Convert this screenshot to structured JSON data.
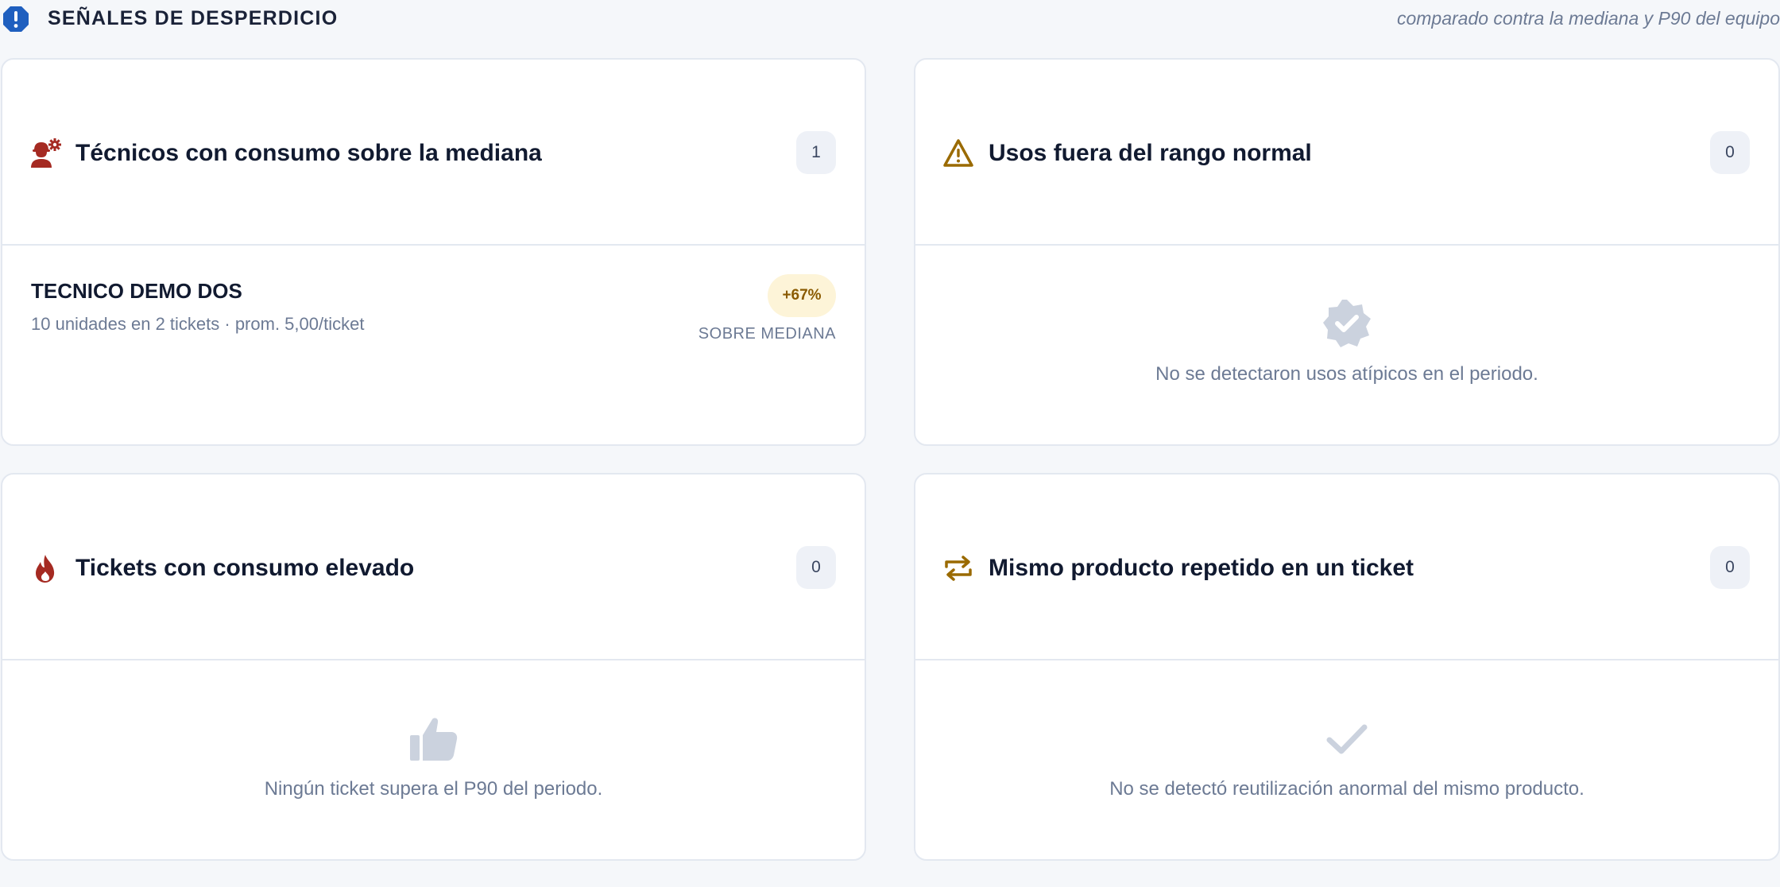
{
  "header": {
    "icon": "alert-octagon-icon",
    "title": "SEÑALES DE DESPERDICIO",
    "subtitle": "comparado contra la mediana y P90 del equipo"
  },
  "colors": {
    "accent_blue": "#1f5fbf",
    "danger_red": "#a52a22",
    "warning_amber": "#9a6a00",
    "muted_icon": "#cbd2de",
    "badge_bg": "#eef1f7",
    "percent_badge_bg": "#fdf4d8"
  },
  "cards": [
    {
      "icon": "user-gear-icon",
      "title": "Técnicos con consumo sobre la mediana",
      "count": "1",
      "rows": [
        {
          "name": "TECNICO DEMO DOS",
          "detail": "10 unidades en 2 tickets · prom. 5,00/ticket",
          "percent": "+67%",
          "percent_label": "SOBRE MEDIANA"
        }
      ]
    },
    {
      "icon": "warning-triangle-icon",
      "title": "Usos fuera del rango normal",
      "count": "0",
      "empty_icon": "verified-badge-icon",
      "empty_text": "No se detectaron usos atípicos en el periodo."
    },
    {
      "icon": "fire-icon",
      "title": "Tickets con consumo elevado",
      "count": "0",
      "empty_icon": "thumbs-up-icon",
      "empty_text": "Ningún ticket supera el P90 del periodo."
    },
    {
      "icon": "repeat-icon",
      "title": "Mismo producto repetido en un ticket",
      "count": "0",
      "empty_icon": "check-icon",
      "empty_text": "No se detectó reutilización anormal del mismo producto."
    }
  ]
}
